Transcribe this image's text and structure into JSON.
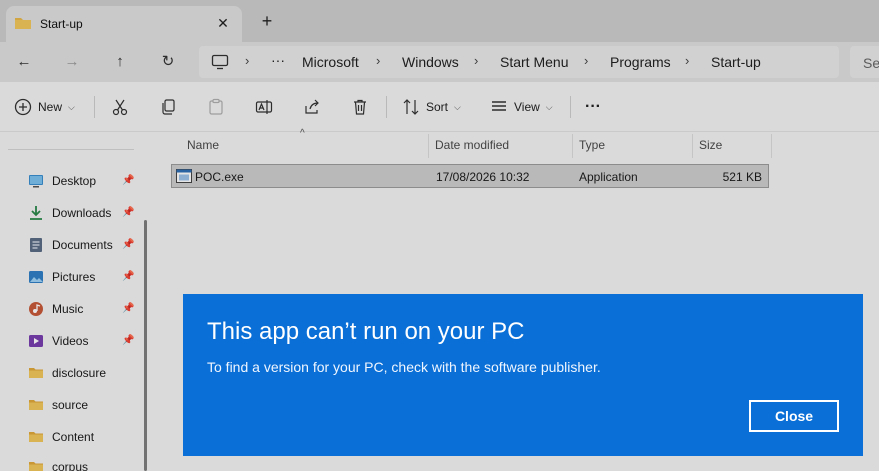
{
  "tab": {
    "title": "Start-up",
    "close_glyph": "✕",
    "new_tab_glyph": "+"
  },
  "nav": {
    "back_glyph": "←",
    "forward_glyph": "→",
    "up_glyph": "↑",
    "refresh_glyph": "↻",
    "more_glyph": "···",
    "breadcrumb": [
      "Microsoft",
      "Windows",
      "Start Menu",
      "Programs",
      "Start-up"
    ],
    "separator": "›",
    "search_placeholder": "Se"
  },
  "toolbar": {
    "new_label": "New",
    "sort_label": "Sort",
    "view_label": "View",
    "more_glyph": "···"
  },
  "sidebar": {
    "items": [
      {
        "label": "Desktop",
        "icon": "desktop-icon",
        "pinned": true
      },
      {
        "label": "Downloads",
        "icon": "downloads-icon",
        "pinned": true
      },
      {
        "label": "Documents",
        "icon": "documents-icon",
        "pinned": true
      },
      {
        "label": "Pictures",
        "icon": "pictures-icon",
        "pinned": true
      },
      {
        "label": "Music",
        "icon": "music-icon",
        "pinned": true
      },
      {
        "label": "Videos",
        "icon": "videos-icon",
        "pinned": true
      },
      {
        "label": "disclosure",
        "icon": "folder-icon",
        "pinned": false
      },
      {
        "label": "source",
        "icon": "folder-icon",
        "pinned": false
      },
      {
        "label": "Content",
        "icon": "folder-icon",
        "pinned": false
      },
      {
        "label": "corpus",
        "icon": "folder-icon",
        "pinned": false
      }
    ],
    "pin_glyph": "📌"
  },
  "filelist": {
    "columns": [
      "Name",
      "Date modified",
      "Type",
      "Size"
    ],
    "rows": [
      {
        "name": "POC.exe",
        "date": "17/08/2026 10:32",
        "type": "Application",
        "size": "521 KB"
      }
    ]
  },
  "dialog": {
    "title": "This app can’t run on your PC",
    "message": "To find a version for your PC, check with the software publisher.",
    "close_label": "Close"
  },
  "colors": {
    "dialog_bg": "#0a6fd6",
    "folder": "#e8b84a",
    "accent": "#0a6fd6"
  }
}
